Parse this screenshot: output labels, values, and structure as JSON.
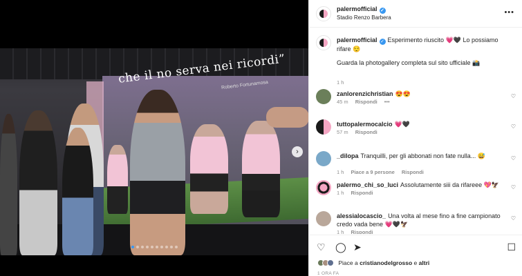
{
  "post": {
    "username": "palermofficial",
    "location": "Stadio Renzo Barbera",
    "more_icon": "more-horizontal-icon",
    "photo_text": {
      "quote": "che il no   serva nei ricordi”",
      "author": "Roberto Fortunamosa"
    },
    "carousel": {
      "total": 10,
      "active_index": 0
    }
  },
  "caption": {
    "username": "palermofficial",
    "text": "Esperimento riuscito 💗🖤 Lo possiamo rifare 😌",
    "text2": "Guarda la photogallery completa sul sito ufficiale 📸",
    "time": "1 h"
  },
  "comments": [
    {
      "username": "zanlorenzichristian",
      "text": "😍😍",
      "time": "45 m",
      "reply": "Rispondi",
      "extra": "•••",
      "likes": ""
    },
    {
      "username": "tuttopalermocalcio",
      "text": "💗🖤",
      "time": "57 m",
      "reply": "Rispondi",
      "extra": "",
      "likes": ""
    },
    {
      "username": "_dilopa",
      "text": "Tranquilli, per gli abbonati non fate nulla... 😅",
      "time": "1 h",
      "reply": "Rispondi",
      "extra": "",
      "likes": "Piace a 9 persone"
    },
    {
      "username": "palermo_chi_so_luci",
      "text": "Assolutamente siii da rifareee 💖🦅",
      "time": "1 h",
      "reply": "Rispondi",
      "extra": "",
      "likes": ""
    },
    {
      "username": "alessialocascio_",
      "text": "Una volta al mese fino a fine campionato credo vada bene 💗🖤🦅",
      "time": "1 h",
      "reply": "Rispondi",
      "extra": "",
      "likes": ""
    }
  ],
  "actions": {
    "like_icon": "heart-icon",
    "comment_icon": "comment-icon",
    "share_icon": "send-icon",
    "save_icon": "bookmark-icon"
  },
  "likes": {
    "prefix": "Piace a",
    "user": "cristianodelgrosso",
    "suffix": "e",
    "others": "altri"
  },
  "posted": "1 ORA FA",
  "colors": {
    "accent": "#3897f0",
    "pink": "#f4a6c3"
  }
}
